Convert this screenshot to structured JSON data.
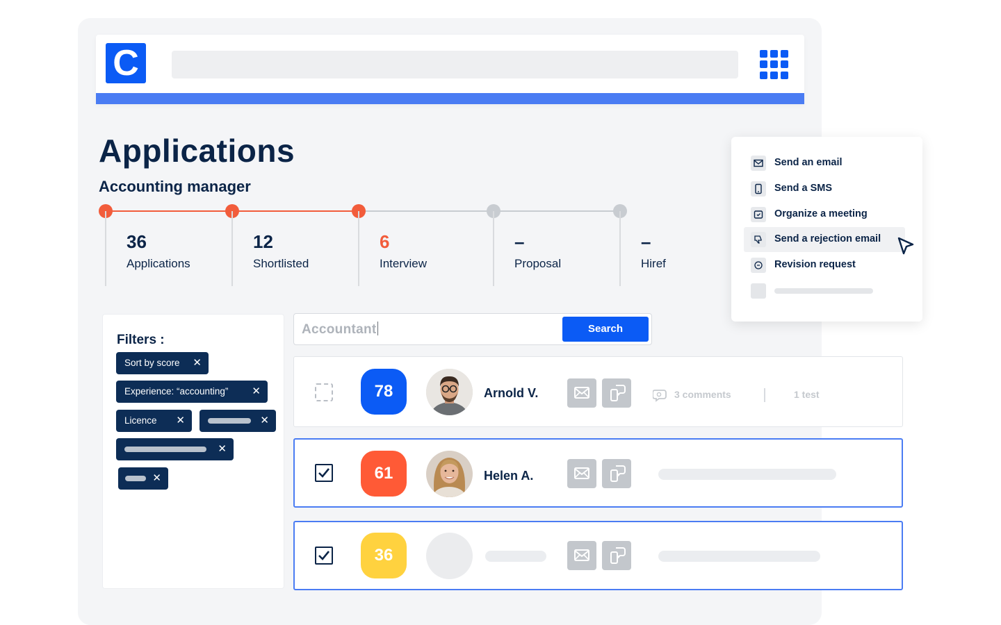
{
  "header": {
    "logo_letter": "C"
  },
  "page": {
    "title": "Applications",
    "job": "Accounting manager"
  },
  "pipeline": [
    {
      "count": "36",
      "label": "Applications",
      "active": true
    },
    {
      "count": "12",
      "label": "Shortlisted",
      "active": true
    },
    {
      "count": "6",
      "label": "Interview",
      "active": true
    },
    {
      "count": "–",
      "label": "Proposal",
      "active": false
    },
    {
      "count": "–",
      "label": "Hiref",
      "active": false
    }
  ],
  "filters": {
    "title": "Filters :",
    "chips": [
      "Sort by score",
      "Experience: “accounting”",
      "Licence"
    ],
    "remove_symbol": "✕"
  },
  "search": {
    "value": "Accountant",
    "button": "Search"
  },
  "candidates": [
    {
      "score": "78",
      "score_color": "#0b5bf5",
      "name": "Arnold V.",
      "checked": false,
      "comments": "3 comments",
      "tests": "1 test"
    },
    {
      "score": "61",
      "score_color": "#ff5a36",
      "name": "Helen A.",
      "checked": true
    },
    {
      "score": "36",
      "score_color": "#ffd23f",
      "name": "",
      "checked": true
    }
  ],
  "actions_menu": {
    "items": [
      "Send an email",
      "Send a SMS",
      "Organize a meeting",
      "Send a rejection email",
      "Revision request"
    ],
    "active_item": "Send a rejection email"
  },
  "colors": {
    "accent": "#0b5bf5",
    "pipeline_active": "#f25c3b",
    "pipeline_inactive": "#c8ccd1",
    "navy": "#0b2447"
  }
}
